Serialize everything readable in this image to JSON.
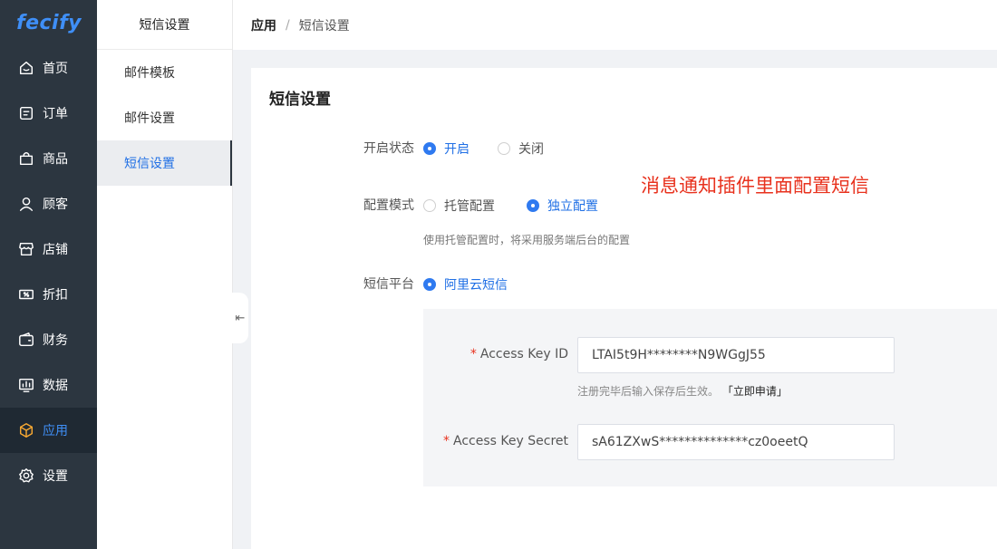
{
  "nav": {
    "logo": "fecify",
    "items": [
      {
        "label": "首页",
        "icon": "home-icon"
      },
      {
        "label": "订单",
        "icon": "order-icon"
      },
      {
        "label": "商品",
        "icon": "bag-icon"
      },
      {
        "label": "顾客",
        "icon": "user-icon"
      },
      {
        "label": "店铺",
        "icon": "store-icon"
      },
      {
        "label": "折扣",
        "icon": "discount-icon"
      },
      {
        "label": "财务",
        "icon": "wallet-icon"
      },
      {
        "label": "数据",
        "icon": "chart-icon"
      },
      {
        "label": "应用",
        "icon": "box-icon",
        "active": true
      },
      {
        "label": "设置",
        "icon": "gear-icon"
      }
    ]
  },
  "submenu": {
    "title": "短信设置",
    "items": [
      {
        "label": "邮件模板"
      },
      {
        "label": "邮件设置"
      },
      {
        "label": "短信设置",
        "active": true
      }
    ]
  },
  "breadcrumb": {
    "level1": "应用",
    "separator": "/",
    "level2": "短信设置"
  },
  "card": {
    "title": "短信设置",
    "status": {
      "label": "开启状态",
      "on": "开启",
      "off": "关闭",
      "selected": "开启"
    },
    "mode": {
      "label": "配置模式",
      "hosted": "托管配置",
      "independent": "独立配置",
      "selected": "独立配置",
      "hint": "使用托管配置时，将采用服务端后台的配置"
    },
    "platform": {
      "label": "短信平台",
      "option": "阿里云短信"
    },
    "annotation": "消息通知插件里面配置短信",
    "access_key_id": {
      "label": "Access Key ID",
      "value": "LTAI5t9H********N9WGgJ55"
    },
    "hint_prefix": "注册完毕后输入保存后生效。",
    "hint_link": "「立即申请」",
    "access_key_secret": {
      "label": "Access Key Secret",
      "value": "sA61ZXwS**************cz0oeetQ"
    }
  },
  "colors": {
    "accent": "#2f7af0",
    "nav_bg": "#2c3640",
    "annotation": "#e8321e",
    "active_icon": "#f7a832"
  }
}
